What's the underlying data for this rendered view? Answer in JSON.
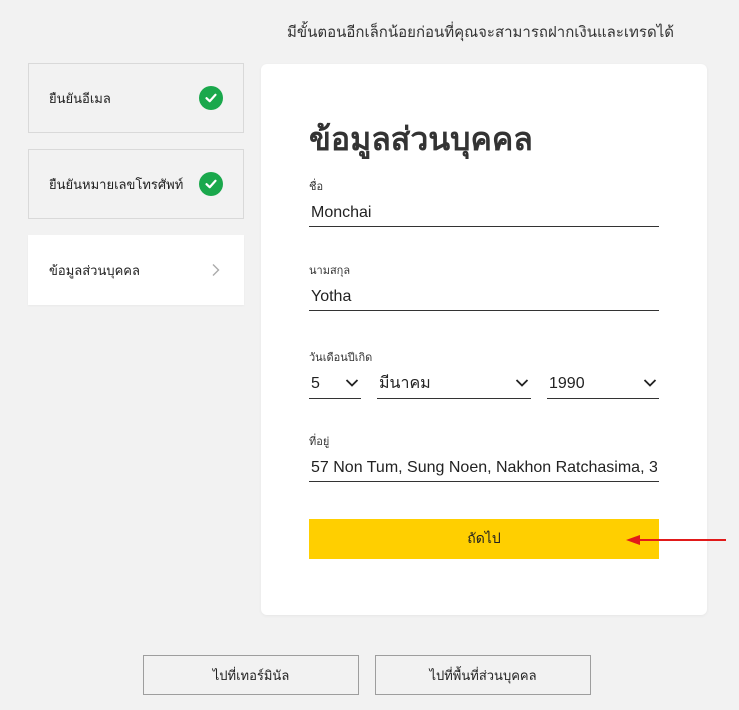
{
  "header": {
    "message": "มีขั้นตอนอีกเล็กน้อยก่อนที่คุณจะสามารถฝากเงินและเทรดได้"
  },
  "steps": [
    {
      "label": "ยืนยันอีเมล",
      "status": "done",
      "icon": "check-icon"
    },
    {
      "label": "ยืนยันหมายเลขโทรศัพท์",
      "status": "done",
      "icon": "check-icon"
    },
    {
      "label": "ข้อมูลส่วนบุคคล",
      "status": "current",
      "icon": "chevron-right-icon"
    }
  ],
  "form": {
    "title": "ข้อมูลส่วนบุคคล",
    "first_name": {
      "label": "ชื่อ",
      "value": "Monchai"
    },
    "last_name": {
      "label": "นามสกุล",
      "value": "Yotha"
    },
    "dob": {
      "label": "วันเดือนปีเกิด",
      "day": "5",
      "month": "มีนาคม",
      "year": "1990"
    },
    "address": {
      "label": "ที่อยู่",
      "value": "57 Non Tum, Sung Noen, Nakhon Ratchasima, 3"
    },
    "next_label": "ถัดไป"
  },
  "footer": {
    "terminal_label": "ไปที่เทอร์มินัล",
    "personal_area_label": "ไปที่พื้นที่ส่วนบุคคล"
  },
  "colors": {
    "accent": "#ffcf00",
    "success": "#1aa84c",
    "annotation_arrow": "#e11a1a"
  }
}
